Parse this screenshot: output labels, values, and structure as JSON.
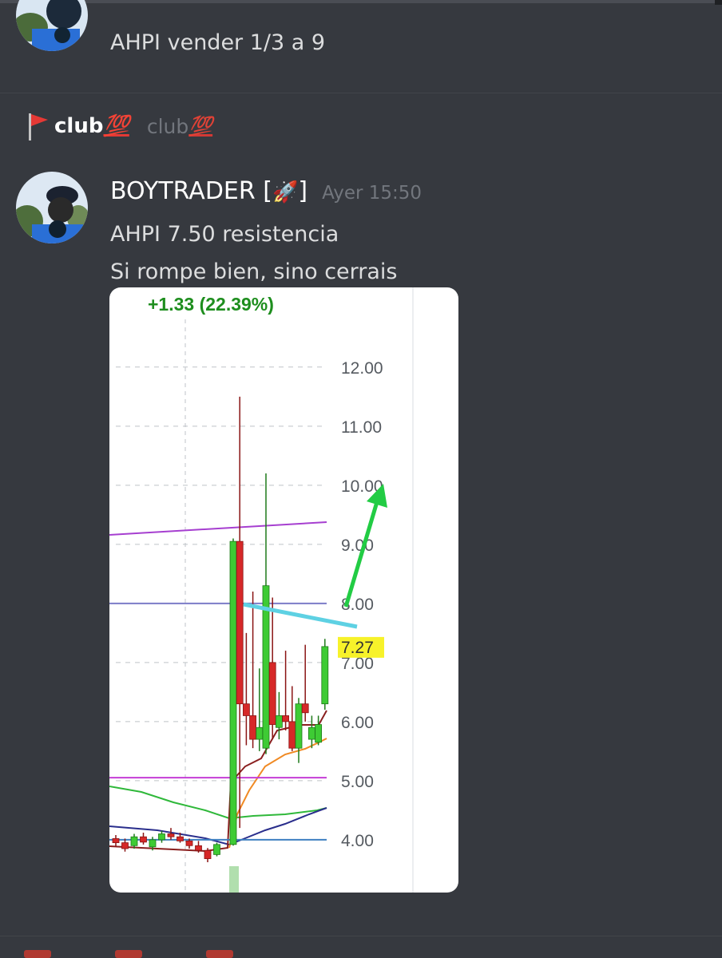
{
  "prev_message": {
    "text": "AHPI vender 1/3 a 9"
  },
  "server_header": {
    "name": "club",
    "emoji": "💯",
    "alt_name": "club",
    "alt_emoji": "💯",
    "icon": "red-flag-icon"
  },
  "message": {
    "author": "BOYTRADER [",
    "author_emoji": "🚀",
    "author_end": "]",
    "timestamp": "Ayer 15:50",
    "lines": [
      "AHPI 7.50 resistencia",
      "Si rompe bien, sino cerrais"
    ]
  },
  "chart_data": {
    "type": "candlestick",
    "change_label": "+1.33 (22.39%)",
    "y_ticks": [
      "12.00",
      "11.00",
      "10.00",
      "9.00",
      "8.00",
      "7.00",
      "6.00",
      "5.00",
      "4.00"
    ],
    "ylim": [
      3.35,
      12.7
    ],
    "last_price": "7.27",
    "candles": [
      {
        "o": 4.02,
        "h": 4.08,
        "l": 3.88,
        "c": 3.95
      },
      {
        "o": 3.95,
        "h": 4.02,
        "l": 3.8,
        "c": 3.85
      },
      {
        "o": 3.9,
        "h": 4.1,
        "l": 3.85,
        "c": 4.05
      },
      {
        "o": 4.05,
        "h": 4.12,
        "l": 3.92,
        "c": 3.96
      },
      {
        "o": 3.88,
        "h": 4.05,
        "l": 3.82,
        "c": 4.0
      },
      {
        "o": 4.0,
        "h": 4.15,
        "l": 3.95,
        "c": 4.1
      },
      {
        "o": 4.1,
        "h": 4.2,
        "l": 4.0,
        "c": 4.05
      },
      {
        "o": 4.05,
        "h": 4.12,
        "l": 3.95,
        "c": 3.98
      },
      {
        "o": 3.98,
        "h": 4.02,
        "l": 3.85,
        "c": 3.9
      },
      {
        "o": 3.9,
        "h": 3.98,
        "l": 3.78,
        "c": 3.82
      },
      {
        "o": 3.82,
        "h": 3.86,
        "l": 3.62,
        "c": 3.68
      },
      {
        "o": 3.75,
        "h": 3.95,
        "l": 3.72,
        "c": 3.92
      },
      {
        "o": 3.92,
        "h": 9.1,
        "l": 3.9,
        "c": 9.05
      },
      {
        "o": 9.05,
        "h": 11.5,
        "l": 4.2,
        "c": 6.3
      },
      {
        "o": 6.3,
        "h": 7.5,
        "l": 5.6,
        "c": 6.1
      },
      {
        "o": 6.1,
        "h": 8.2,
        "l": 5.55,
        "c": 5.7
      },
      {
        "o": 5.7,
        "h": 6.9,
        "l": 5.5,
        "c": 5.9
      },
      {
        "o": 5.55,
        "h": 10.2,
        "l": 5.45,
        "c": 8.3
      },
      {
        "o": 7.0,
        "h": 8.1,
        "l": 5.7,
        "c": 5.95
      },
      {
        "o": 5.9,
        "h": 6.5,
        "l": 5.7,
        "c": 6.1
      },
      {
        "o": 6.1,
        "h": 7.2,
        "l": 5.85,
        "c": 6.0
      },
      {
        "o": 6.0,
        "h": 6.6,
        "l": 5.5,
        "c": 5.55
      },
      {
        "o": 5.55,
        "h": 6.4,
        "l": 5.3,
        "c": 6.3
      },
      {
        "o": 6.3,
        "h": 7.3,
        "l": 6.0,
        "c": 6.15
      },
      {
        "o": 5.7,
        "h": 6.1,
        "l": 5.55,
        "c": 5.9
      },
      {
        "o": 5.65,
        "h": 6.1,
        "l": 5.6,
        "c": 5.95
      },
      {
        "o": 6.3,
        "h": 7.4,
        "l": 6.2,
        "c": 7.27
      }
    ],
    "horizontal_lines": [
      {
        "value": 8.0,
        "color": "#7c7cc8"
      },
      {
        "value": 5.05,
        "color": "#c43dd6"
      },
      {
        "value": 4.0,
        "color": "#3e7fc1"
      }
    ],
    "colors": {
      "up": "#3ecb34",
      "down": "#d62828",
      "grid": "#bfc3c8",
      "tick_label": "#555a60",
      "trend_line": "#5ed1e3",
      "arrow": "#22cc44",
      "price_tag_bg": "#f7f22a",
      "volume": "#9dd79a"
    }
  }
}
